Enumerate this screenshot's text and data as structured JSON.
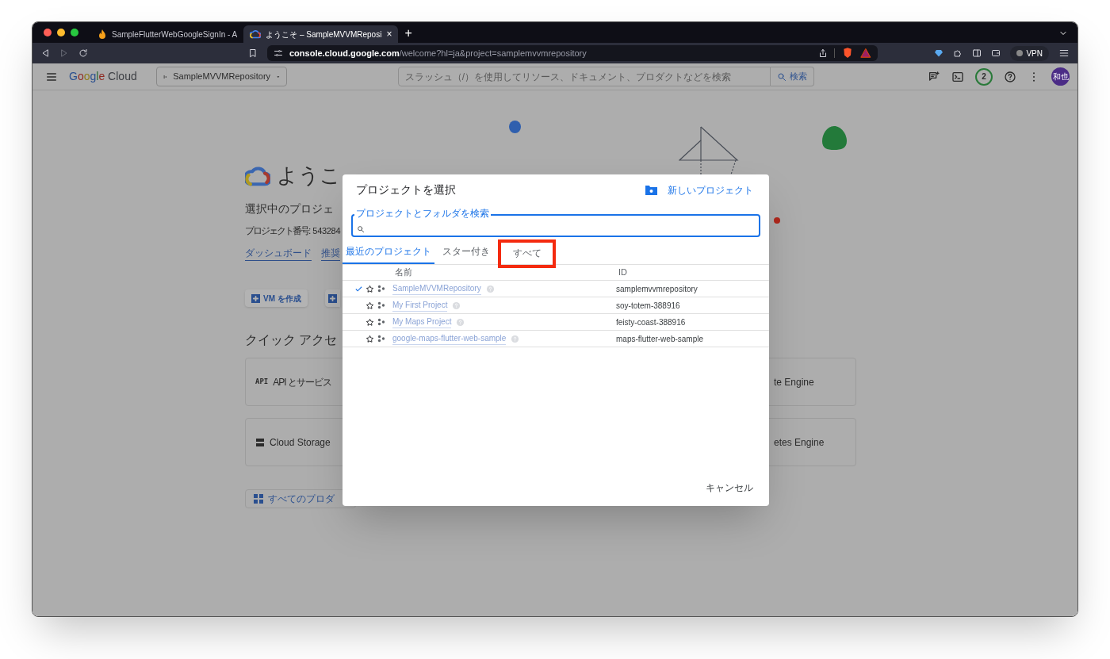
{
  "browser": {
    "tabs": [
      {
        "title": "SampleFlutterWebGoogleSignIn - A",
        "selected": false
      },
      {
        "title": "ようこそ – SampleMVVMReposi",
        "selected": true,
        "close": "×"
      }
    ],
    "new_tab": "+",
    "url_host": "console.cloud.google.com",
    "url_path": "/welcome?hl=ja&project=samplemvvmrepository",
    "vpn": "VPN"
  },
  "console_header": {
    "logo": "Google Cloud",
    "project": "SampleMVVMRepository",
    "search_placeholder": "スラッシュ（/）を使用してリソース、ドキュメント、プロダクトなどを検索",
    "search_button": "検索",
    "notifications": "2",
    "avatar": "和也"
  },
  "welcome": {
    "heading": "ようこ",
    "selected_project": "選択中のプロジェ",
    "project_number_label": "プロジェクト番号:",
    "project_number": "543284",
    "links": [
      "ダッシュボード",
      "推奨"
    ],
    "buttons": [
      {
        "kind": "labeled",
        "label": "VM を作成"
      },
      {
        "kind": "icon-only"
      }
    ],
    "quick_access_title": "クイック アクセ",
    "quick_access": [
      {
        "kind": "api",
        "icon_text": "API",
        "label": "API とサービス"
      },
      {
        "kind": "plain",
        "label": "te Engine"
      },
      {
        "kind": "storage",
        "label": "Cloud Storage"
      },
      {
        "kind": "plain",
        "label": "etes Engine"
      }
    ],
    "all_products": "すべてのプロダ"
  },
  "dialog": {
    "title": "プロジェクトを選択",
    "new_project": "新しいプロジェクト",
    "search_label": "プロジェクトとフォルダを検索",
    "tabs": [
      {
        "label": "最近のプロジェクト",
        "selected": true,
        "highlighted": false
      },
      {
        "label": "スター付き",
        "selected": false,
        "highlighted": false
      },
      {
        "label": "すべて",
        "selected": false,
        "highlighted": true
      }
    ],
    "columns": [
      "名前",
      "ID"
    ],
    "rows": [
      {
        "name": "SampleMVVMRepository",
        "id": "samplemvvmrepository",
        "current": true,
        "starred": false
      },
      {
        "name": "My First Project",
        "id": "soy-totem-388916",
        "current": false,
        "starred": false
      },
      {
        "name": "My Maps Project",
        "id": "feisty-coast-388916",
        "current": false,
        "starred": false
      },
      {
        "name": "google-maps-flutter-web-sample",
        "id": "maps-flutter-web-sample",
        "current": false,
        "starred": false
      }
    ],
    "cancel": "キャンセル"
  }
}
